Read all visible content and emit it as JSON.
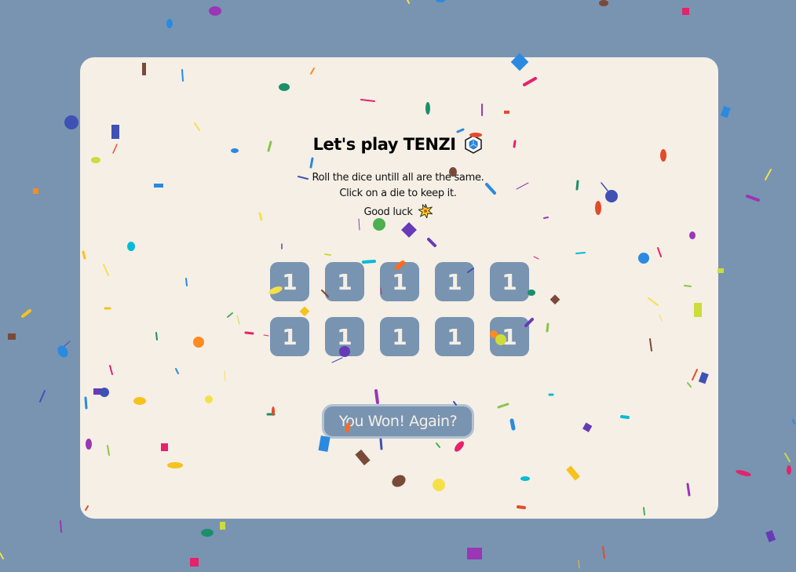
{
  "header": {
    "title": "Let's play TENZI",
    "title_icon": "dice-icon"
  },
  "instructions": {
    "line1": "Roll the dice untill all are the same.",
    "line2": "Click on a die to keep it.",
    "line3": "Good luck",
    "line3_icon": "sparkle-icon"
  },
  "dice": [
    {
      "value": "1"
    },
    {
      "value": "1"
    },
    {
      "value": "1"
    },
    {
      "value": "1"
    },
    {
      "value": "1"
    },
    {
      "value": "1"
    },
    {
      "value": "1"
    },
    {
      "value": "1"
    },
    {
      "value": "1"
    },
    {
      "value": "1"
    }
  ],
  "action_button": {
    "label": "You Won! Again?"
  },
  "colors": {
    "background": "#7894b1",
    "board": "#f5efe6",
    "die": "#7894b1",
    "die_text": "#f5efe6",
    "button_border": "#b3c1d1"
  }
}
